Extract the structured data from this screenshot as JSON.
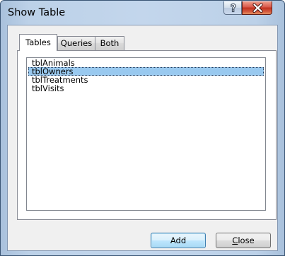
{
  "window": {
    "title": "Show Table",
    "help_icon": "question-mark",
    "close_icon": "x"
  },
  "tabs": [
    {
      "label": "Tables",
      "active": true
    },
    {
      "label": "Queries",
      "active": false
    },
    {
      "label": "Both",
      "active": false
    }
  ],
  "list": {
    "items": [
      "tblAnimals",
      "tblOwners",
      "tblTreatments",
      "tblVisits"
    ],
    "selected": "tblOwners",
    "selection_color": "#99c9ef"
  },
  "buttons": {
    "add_label": "Add",
    "close_label": "Close",
    "close_mnemonic": "C"
  }
}
